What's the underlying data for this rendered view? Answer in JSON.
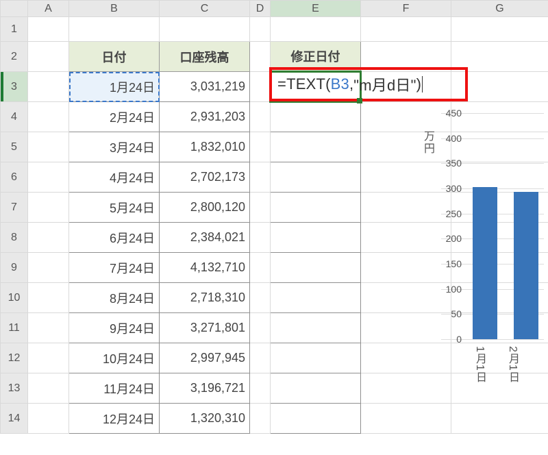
{
  "columns": [
    "A",
    "B",
    "C",
    "D",
    "E",
    "F",
    "G"
  ],
  "row_headers": [
    "1",
    "2",
    "3",
    "4",
    "5",
    "6",
    "7",
    "8",
    "9",
    "10",
    "11",
    "12",
    "13",
    "14"
  ],
  "active_cell": "E3",
  "referenced_cell": "B3",
  "table": {
    "headers": {
      "B": "日付",
      "C": "口座残高",
      "E": "修正日付"
    },
    "rows": [
      {
        "B": "1月24日",
        "C": "3,031,219"
      },
      {
        "B": "2月24日",
        "C": "2,931,203"
      },
      {
        "B": "3月24日",
        "C": "1,832,010"
      },
      {
        "B": "4月24日",
        "C": "2,702,173"
      },
      {
        "B": "5月24日",
        "C": "2,800,120"
      },
      {
        "B": "6月24日",
        "C": "2,384,021"
      },
      {
        "B": "7月24日",
        "C": "4,132,710"
      },
      {
        "B": "8月24日",
        "C": "2,718,310"
      },
      {
        "B": "9月24日",
        "C": "3,271,801"
      },
      {
        "B": "10月24日",
        "C": "2,997,945"
      },
      {
        "B": "11月24日",
        "C": "3,196,721"
      },
      {
        "B": "12月24日",
        "C": "1,320,310"
      }
    ]
  },
  "formula": {
    "prefix": "=",
    "fn_open": "TEXT(",
    "ref": "B3",
    "sep": ",",
    "str": "\"m月d日\"",
    "close": ")"
  },
  "chart_data": {
    "type": "bar",
    "ylabel": "万円",
    "ylim": [
      0,
      450
    ],
    "ytick_step": 50,
    "categories": [
      "1月1日",
      "2月1日"
    ],
    "values": [
      303,
      293
    ],
    "note": "values visually estimated from bar heights; full chart cropped on right"
  }
}
